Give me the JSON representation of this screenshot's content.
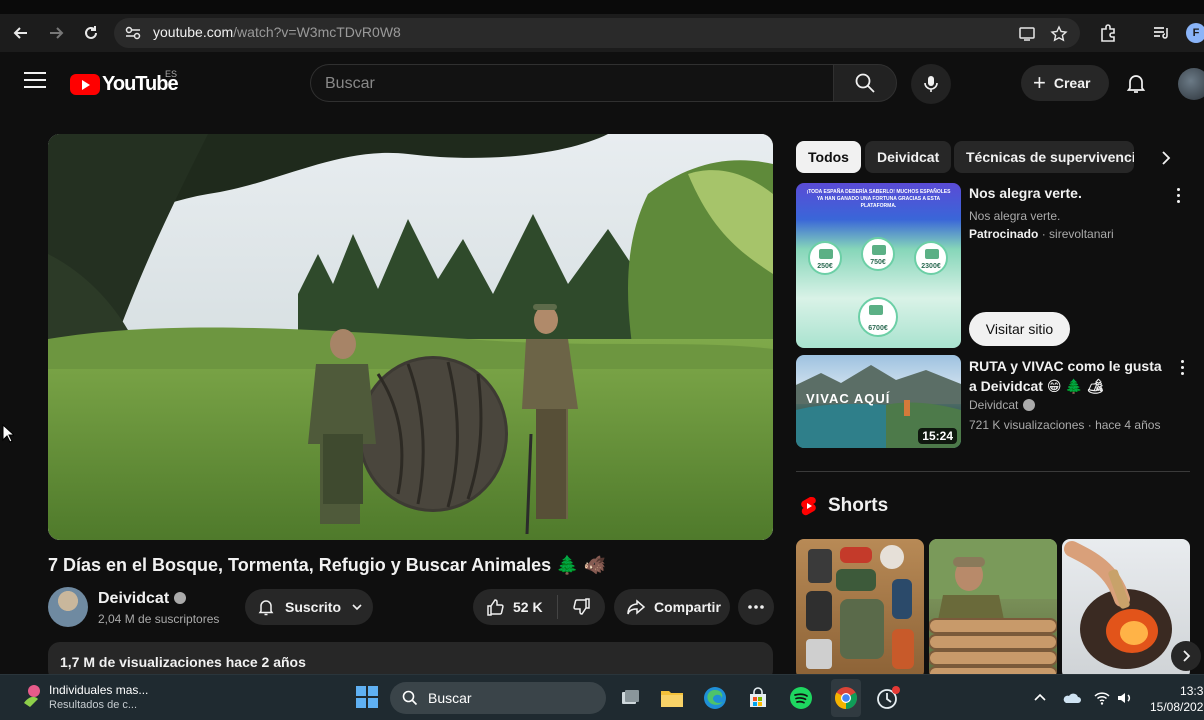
{
  "browser": {
    "url_host": "youtube.com",
    "url_path": "/watch?v=W3mcTDvR0W8",
    "profile_initial": "F"
  },
  "masthead": {
    "logo_text": "YouTube",
    "region": "ES",
    "search_placeholder": "Buscar",
    "create_label": "Crear"
  },
  "video": {
    "title": "7 Días en el Bosque, Tormenta, Refugio y Buscar Animales 🌲 🐗",
    "channel": "Deividcat",
    "subscribers": "2,04 M de suscriptores",
    "subscribe_label": "Suscrito",
    "likes": "52 K",
    "share_label": "Compartir",
    "views_and_date": "1,7 M de visualizaciones  hace 2 años"
  },
  "chips": [
    {
      "label": "Todos",
      "active": true
    },
    {
      "label": "Deividcat",
      "active": false
    },
    {
      "label": "Técnicas de supervivencia",
      "active": false
    }
  ],
  "ad": {
    "banner_text": "¡TODA ESPAÑA DEBERÍA SABERLO! MUCHOS ESPAÑOLES YA HAN GANADO UNA FORTUNA GRACIAS A ESTA PLATAFORMA.",
    "amounts": [
      "250€",
      "750€",
      "2300€",
      "6700€"
    ],
    "title": "Nos alegra verte.",
    "description": "Nos alegra verte.",
    "sponsored": "Patrocinado",
    "advertiser": "sirevoltanari",
    "cta": "Visitar sitio"
  },
  "recommended": [
    {
      "thumb_text": "VIVAC AQUÍ",
      "duration": "15:24",
      "title": "RUTA y VIVAC como le gusta a Deividcat 😁 🌲 🏕",
      "channel": "Deividcat",
      "meta": "721 K visualizaciones · hace 4 años"
    }
  ],
  "shorts": {
    "label": "Shorts"
  },
  "taskbar": {
    "news_title": "Individuales mas...",
    "news_sub": "Resultados de c...",
    "search_label": "Buscar",
    "time": "13:3",
    "date": "15/08/202"
  },
  "colors": {
    "youtube_red": "#ff0000",
    "background": "#0f0f0f",
    "pill": "#272727"
  }
}
